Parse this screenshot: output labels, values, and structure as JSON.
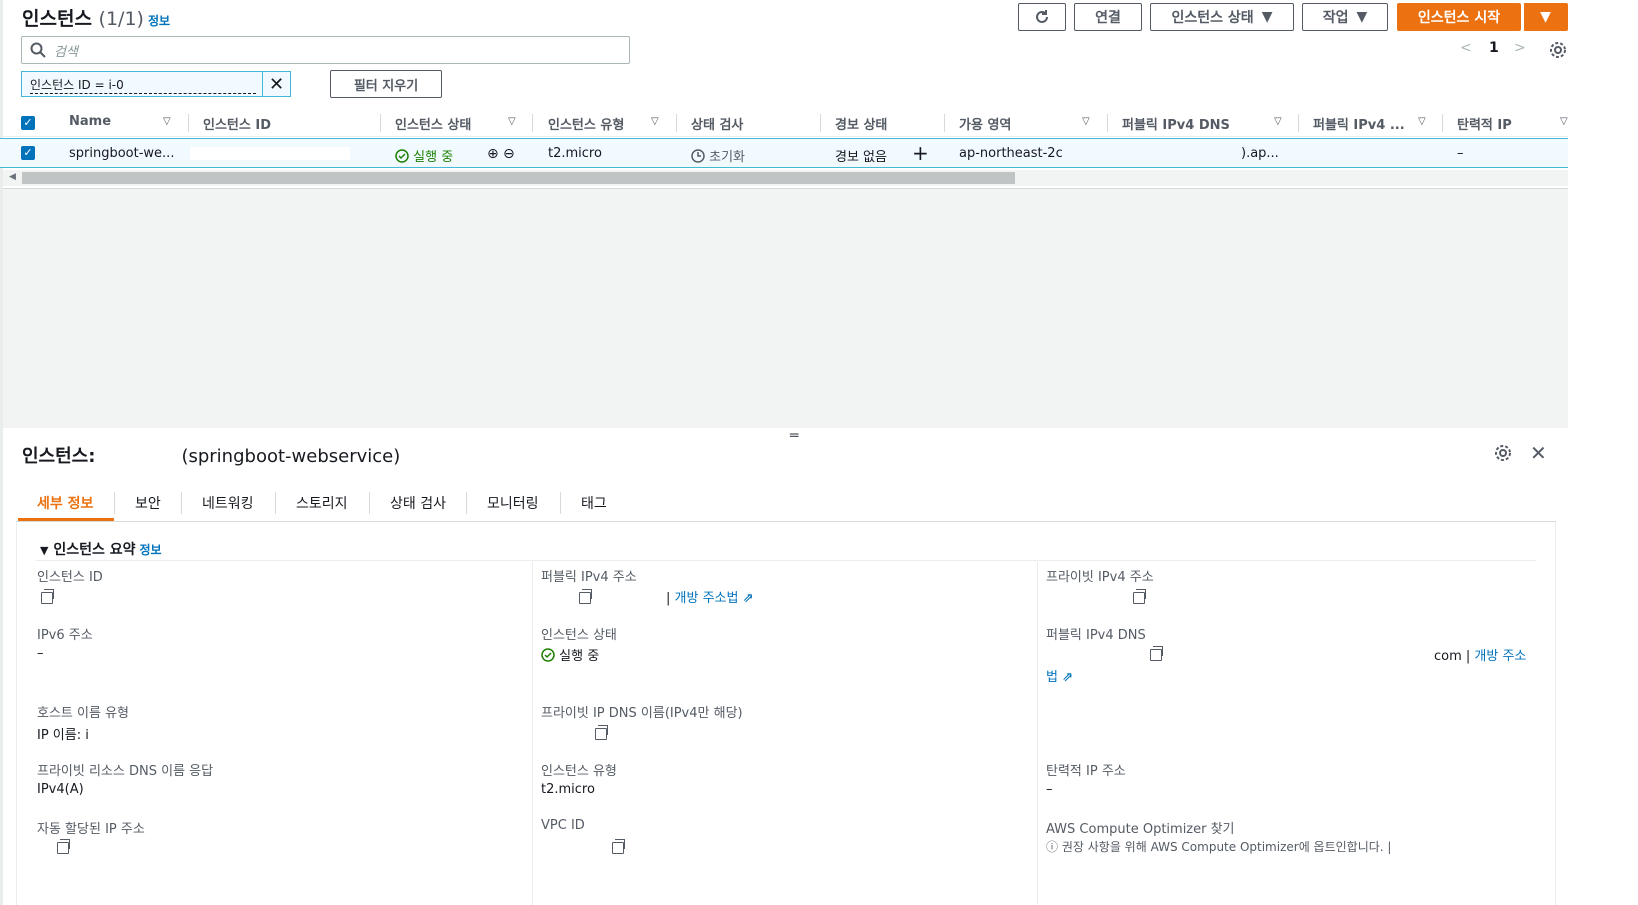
{
  "header": {
    "title": "인스턴스",
    "count": "(1/1)",
    "info_link": "정보",
    "refresh_icon": "refresh-icon",
    "connect_label": "연결",
    "instance_state_label": "인스턴스 상태",
    "actions_label": "작업",
    "launch_label": "인스턴스 시작"
  },
  "search": {
    "placeholder": "검색"
  },
  "filter": {
    "token": "인스턴스 ID = i-0",
    "clear_label": "필터 지우기"
  },
  "pagination": {
    "page": "1"
  },
  "table": {
    "columns": [
      "Name",
      "인스턴스 ID",
      "인스턴스 상태",
      "인스턴스 유형",
      "상태 검사",
      "경보 상태",
      "가용 영역",
      "퍼블릭 IPv4 DNS",
      "퍼블릭 IPv4 ...",
      "탄력적 IP"
    ],
    "row": {
      "name": "springboot-we...",
      "state": "실행 중",
      "type": "t2.micro",
      "status_check": "초기화",
      "alarm": "경보 없음",
      "az": "ap-northeast-2c",
      "dns_suffix": ").ap...",
      "elastic_ip": "–"
    }
  },
  "details": {
    "title_prefix": "인스턴스:",
    "title_suffix": "(springboot-webservice)",
    "tabs": [
      "세부 정보",
      "보안",
      "네트워킹",
      "스토리지",
      "상태 검사",
      "모니터링",
      "태그"
    ],
    "section_title": "인스턴스 요약",
    "section_info": "정보",
    "fields": {
      "instance_id_label": "인스턴스 ID",
      "public_ipv4_label": "퍼블릭 IPv4 주소",
      "open_address": "개방 주소법",
      "private_ipv4_label": "프라이빗 IPv4 주소",
      "ipv6_label": "IPv6 주소",
      "ipv6_value": "–",
      "instance_state_label": "인스턴스 상태",
      "instance_state_value": "실행 중",
      "public_dns_label": "퍼블릭 IPv4 DNS",
      "public_dns_suffix": "com |",
      "open_address_2a": "개방 주소",
      "open_address_2b": "법",
      "hostname_type_label": "호스트 이름 유형",
      "hostname_type_value": "IP 이름: i",
      "private_dns_label": "프라이빗 IP DNS 이름(IPv4만 해당)",
      "answer_label": "프라이빗 리소스 DNS 이름 응답",
      "answer_value": "IPv4(A)",
      "instance_type_label": "인스턴스 유형",
      "instance_type_value": "t2.micro",
      "elastic_ip_label": "탄력적 IP 주소",
      "elastic_ip_value": "–",
      "auto_ip_label": "자동 할당된 IP 주소",
      "vpc_label": "VPC ID",
      "optimizer_label": "AWS Compute Optimizer 찾기",
      "optimizer_value": "권장 사항을 위해 AWS Compute Optimizer에 옵트인합니다. |"
    }
  },
  "colors": {
    "accent": "#ec7211",
    "link": "#0073bb",
    "success": "#1d8102",
    "selection": "#f1faff"
  }
}
